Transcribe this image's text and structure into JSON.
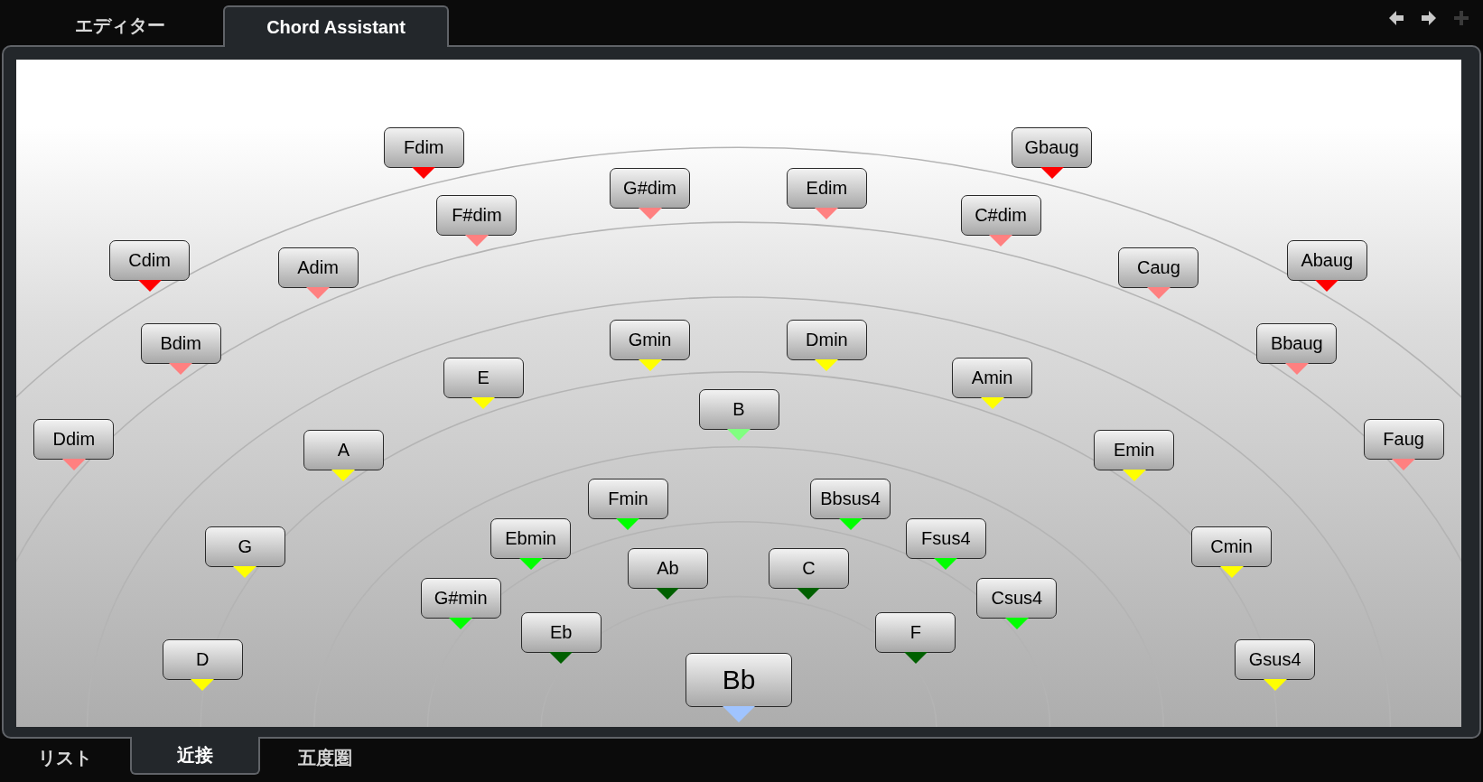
{
  "top_tabs": [
    {
      "label": "エディター",
      "selected": false
    },
    {
      "label": "Chord Assistant",
      "selected": true
    }
  ],
  "nav": [
    {
      "kind": "back",
      "disabled": false
    },
    {
      "kind": "forward",
      "disabled": false
    },
    {
      "kind": "add",
      "disabled": true
    }
  ],
  "chords": [
    {
      "label": "Fdim",
      "color": "#ff0000",
      "current": false
    },
    {
      "label": "Gbaug",
      "color": "#ff0000",
      "current": false
    },
    {
      "label": "G#dim",
      "color": "#ff8080",
      "current": false
    },
    {
      "label": "Edim",
      "color": "#ff8080",
      "current": false
    },
    {
      "label": "F#dim",
      "color": "#ff8080",
      "current": false
    },
    {
      "label": "C#dim",
      "color": "#ff8080",
      "current": false
    },
    {
      "label": "Cdim",
      "color": "#ff0000",
      "current": false
    },
    {
      "label": "Adim",
      "color": "#ff8080",
      "current": false
    },
    {
      "label": "Caug",
      "color": "#ff8080",
      "current": false
    },
    {
      "label": "Abaug",
      "color": "#ff0000",
      "current": false
    },
    {
      "label": "Bdim",
      "color": "#ff8080",
      "current": false
    },
    {
      "label": "Gmin",
      "color": "#ffff00",
      "current": false
    },
    {
      "label": "Dmin",
      "color": "#ffff00",
      "current": false
    },
    {
      "label": "Bbaug",
      "color": "#ff8080",
      "current": false
    },
    {
      "label": "E",
      "color": "#ffff00",
      "current": false
    },
    {
      "label": "Amin",
      "color": "#ffff00",
      "current": false
    },
    {
      "label": "B",
      "color": "#80ff80",
      "current": false
    },
    {
      "label": "Ddim",
      "color": "#ff8080",
      "current": false
    },
    {
      "label": "A",
      "color": "#ffff00",
      "current": false
    },
    {
      "label": "Emin",
      "color": "#ffff00",
      "current": false
    },
    {
      "label": "Faug",
      "color": "#ff8080",
      "current": false
    },
    {
      "label": "Fmin",
      "color": "#00ff00",
      "current": false
    },
    {
      "label": "Bbsus4",
      "color": "#00ff00",
      "current": false
    },
    {
      "label": "G",
      "color": "#ffff00",
      "current": false
    },
    {
      "label": "Ebmin",
      "color": "#00ff00",
      "current": false
    },
    {
      "label": "Fsus4",
      "color": "#00ff00",
      "current": false
    },
    {
      "label": "Cmin",
      "color": "#ffff00",
      "current": false
    },
    {
      "label": "Ab",
      "color": "#006000",
      "current": false
    },
    {
      "label": "C",
      "color": "#006000",
      "current": false
    },
    {
      "label": "G#min",
      "color": "#00ff00",
      "current": false
    },
    {
      "label": "Csus4",
      "color": "#00ff00",
      "current": false
    },
    {
      "label": "Eb",
      "color": "#006000",
      "current": false
    },
    {
      "label": "F",
      "color": "#006000",
      "current": false
    },
    {
      "label": "D",
      "color": "#ffff00",
      "current": false
    },
    {
      "label": "Bb",
      "color": "#a0c4ff",
      "current": true
    },
    {
      "label": "Gsus4",
      "color": "#ffff00",
      "current": false
    }
  ],
  "bottom_tabs": [
    {
      "label": "リスト",
      "selected": false
    },
    {
      "label": "近接",
      "selected": true
    },
    {
      "label": "五度圏",
      "selected": false
    }
  ]
}
